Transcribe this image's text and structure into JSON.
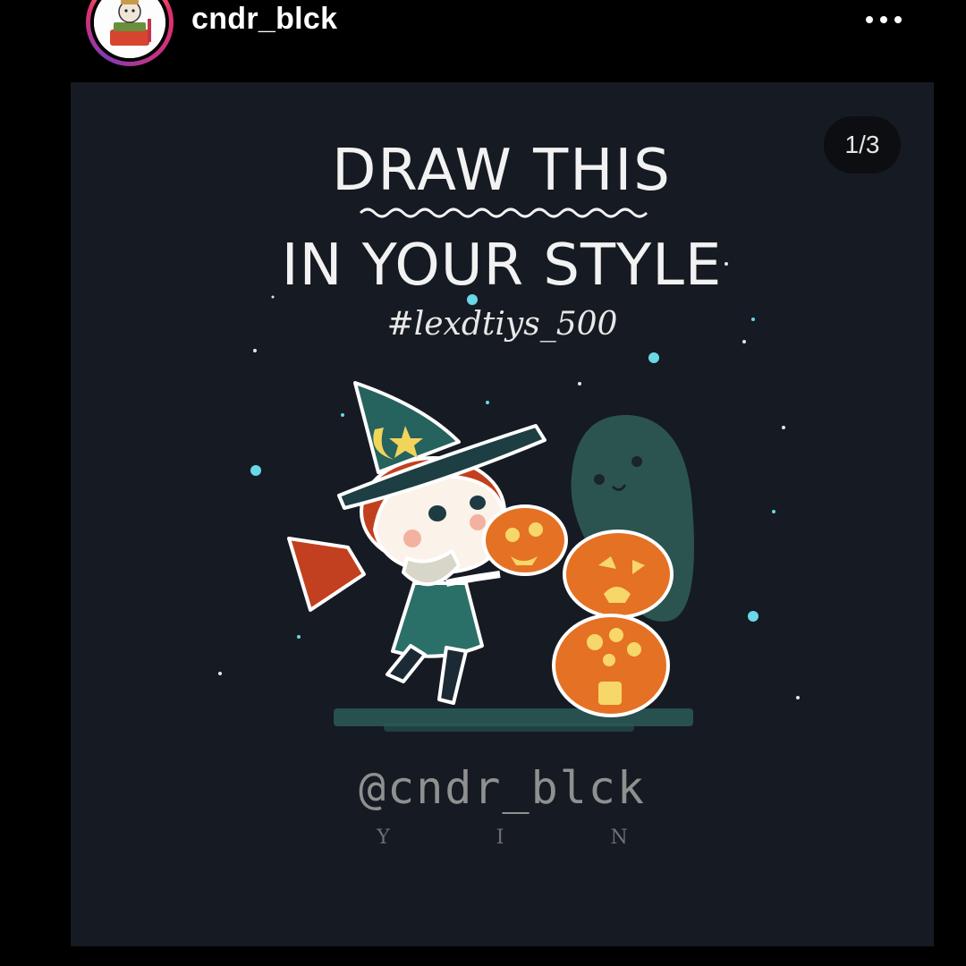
{
  "header": {
    "username": "cndr_blck",
    "more_icon": "more-horizontal-icon"
  },
  "post": {
    "counter": "1/3",
    "artwork": {
      "title_line_1": "DRAW THIS",
      "title_line_2": "IN YOUR STYLE",
      "hashtag": "#lexdtiys_500",
      "handle": "@cndr_blck",
      "sub_handle": "Y I N"
    }
  }
}
